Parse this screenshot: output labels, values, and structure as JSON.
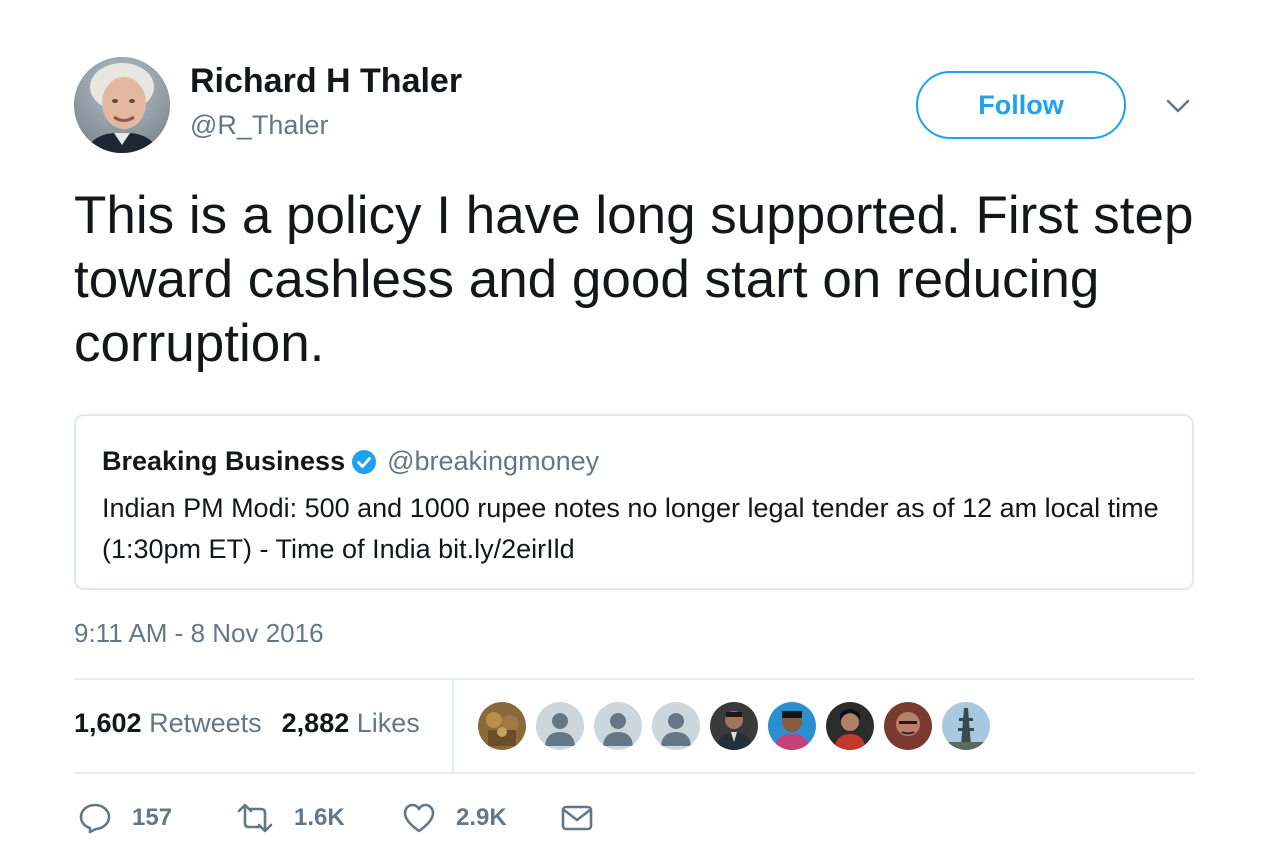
{
  "author": {
    "display_name": "Richard H Thaler",
    "handle": "@R_Thaler",
    "avatar_icon": "user-photo-avatar"
  },
  "follow_button": {
    "label": "Follow"
  },
  "menu_icon": "chevron-down-icon",
  "tweet": {
    "text": "This is a policy I have long supported. First step toward cashless and good start on reducing corruption."
  },
  "quoted_tweet": {
    "display_name": "Breaking Business",
    "verified": true,
    "handle": "@breakingmoney",
    "text": "Indian PM Modi: 500 and 1000 rupee notes no longer legal tender as of 12 am local time (1:30pm ET) - Time of India bit.ly/2eirIld"
  },
  "timestamp": "9:11 AM - 8 Nov 2016",
  "stats": {
    "retweets_count": "1,602",
    "retweets_label": "Retweets",
    "likes_count": "2,882",
    "likes_label": "Likes"
  },
  "liker_avatars": [
    "statue-photo-avatar",
    "default-user-avatar",
    "default-user-avatar",
    "default-user-avatar",
    "user-photo-avatar",
    "user-photo-avatar",
    "user-photo-avatar",
    "user-photo-avatar",
    "tower-photo-avatar"
  ],
  "actions": {
    "reply_count": "157",
    "retweet_count": "1.6K",
    "like_count": "2.9K"
  },
  "colors": {
    "accent": "#1da1f2",
    "text": "#14171a",
    "secondary_text": "#657786",
    "border": "#e1e8ed"
  }
}
